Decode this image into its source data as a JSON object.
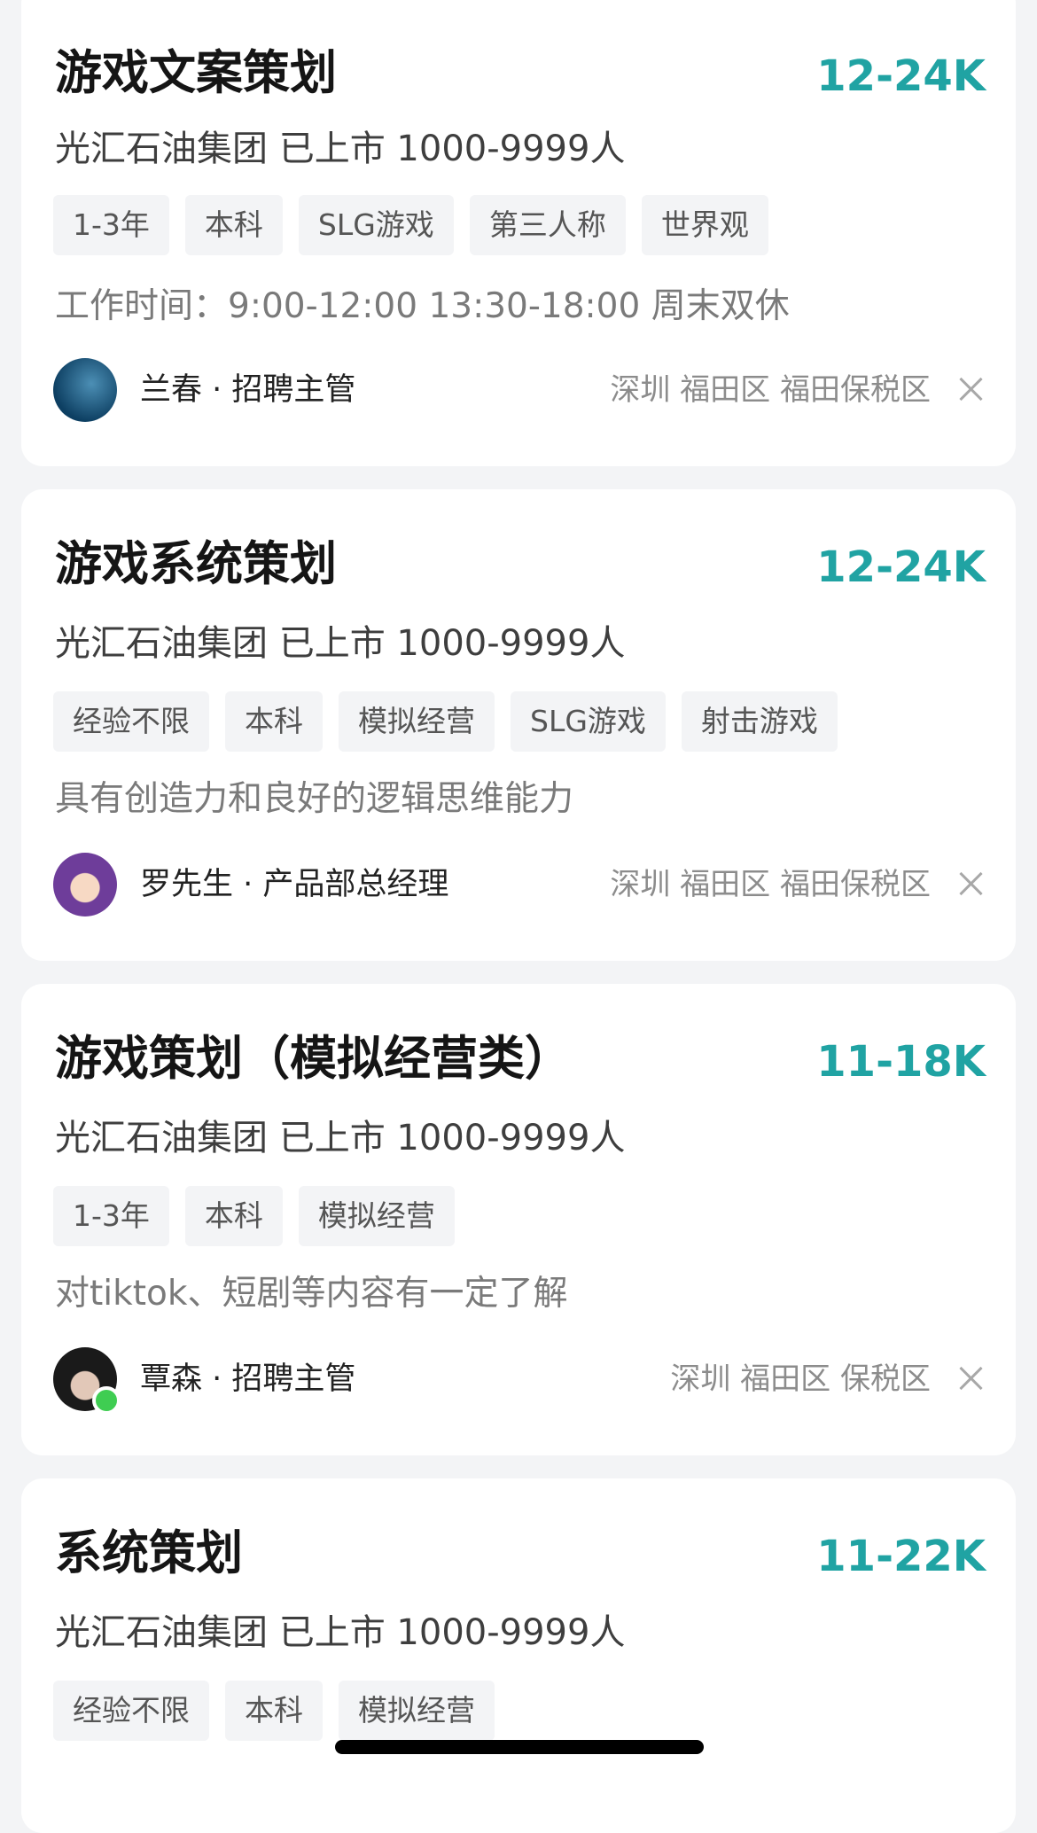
{
  "jobs": [
    {
      "title": "游戏文案策划",
      "salary": "12-24K",
      "company": "光汇石油集团 已上市 1000-9999人",
      "tags": [
        "1-3年",
        "本科",
        "SLG游戏",
        "第三人称",
        "世界观"
      ],
      "description": "工作时间：9:00-12:00 13:30-18:00 周末双休",
      "recruiter": "兰春 · 招聘主管",
      "location": "深圳 福田区 福田保税区"
    },
    {
      "title": "游戏系统策划",
      "salary": "12-24K",
      "company": "光汇石油集团 已上市 1000-9999人",
      "tags": [
        "经验不限",
        "本科",
        "模拟经营",
        "SLG游戏",
        "射击游戏"
      ],
      "description": "具有创造力和良好的逻辑思维能力",
      "recruiter": "罗先生 · 产品部总经理",
      "location": "深圳 福田区 福田保税区"
    },
    {
      "title": "游戏策划（模拟经营类）",
      "salary": "11-18K",
      "company": "光汇石油集团 已上市 1000-9999人",
      "tags": [
        "1-3年",
        "本科",
        "模拟经营"
      ],
      "description": "对tiktok、短剧等内容有一定了解",
      "recruiter": "覃森 · 招聘主管",
      "location": "深圳 福田区 保税区"
    },
    {
      "title": "系统策划",
      "salary": "11-22K",
      "company": "光汇石油集团 已上市 1000-9999人",
      "tags": [
        "经验不限",
        "本科",
        "模拟经营"
      ]
    }
  ]
}
